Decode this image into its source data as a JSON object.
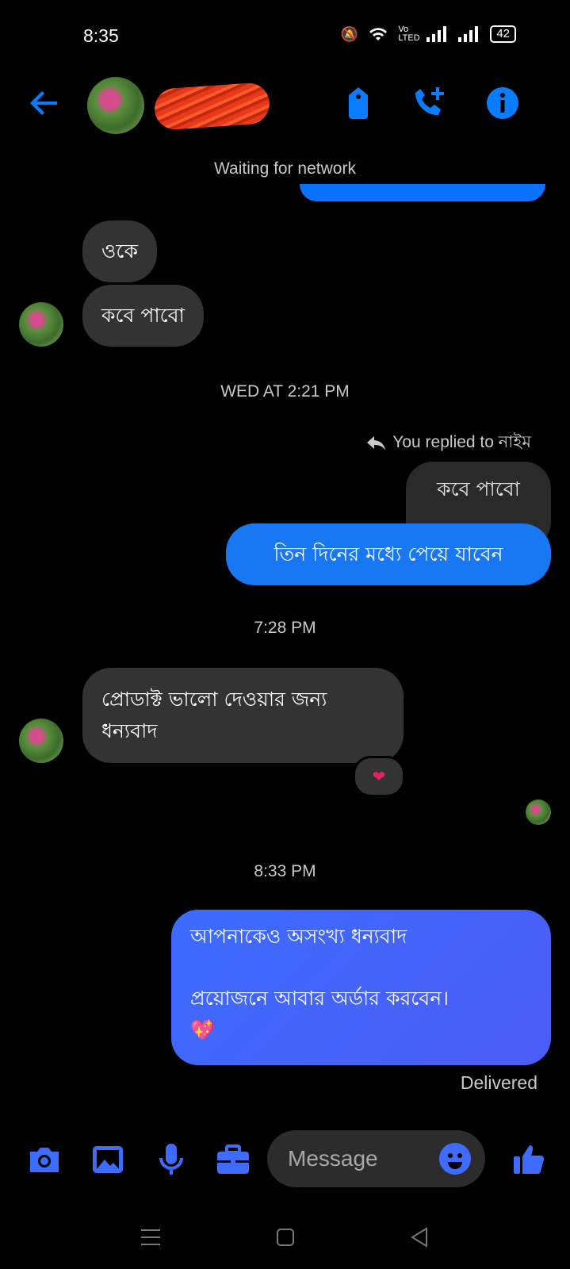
{
  "status": {
    "time": "8:35",
    "network": "Vo LTED",
    "battery": "42"
  },
  "header": {
    "notice": "Waiting for network"
  },
  "messages": {
    "in1": "ওকে",
    "in2": "কবে পাবো",
    "ts1": "WED AT 2:21 PM",
    "reply_note": "You replied to নাইম",
    "reply_original": "কবে পাবো",
    "out1": "তিন দিনের মধ্যে পেয়ে যাবেন",
    "ts2": "7:28 PM",
    "in3_line1": "প্রোডাক্ট ভালো দেওয়ার জন্য",
    "in3_line2": "ধন্যবাদ",
    "reaction": "❤",
    "ts3": "8:33 PM",
    "out2_line1": "আপনাকেও অসংখ্য ধন্যবাদ",
    "out2_line2": "প্রয়োজনে আবার অর্ডার করবেন।",
    "out2_emoji": "💖",
    "delivered": "Delivered"
  },
  "composer": {
    "placeholder": "Message"
  },
  "colors": {
    "accent": "#0a7cff",
    "bubble_out": "#1877f2",
    "bubble_in": "#333334",
    "composer_accent": "#3d6cff"
  },
  "icons": [
    "back-arrow-icon",
    "tag-icon",
    "call-add-icon",
    "info-icon",
    "camera-icon",
    "image-icon",
    "mic-icon",
    "briefcase-icon",
    "emoji-icon",
    "like-icon",
    "menu-icon",
    "home-icon",
    "back-icon"
  ]
}
